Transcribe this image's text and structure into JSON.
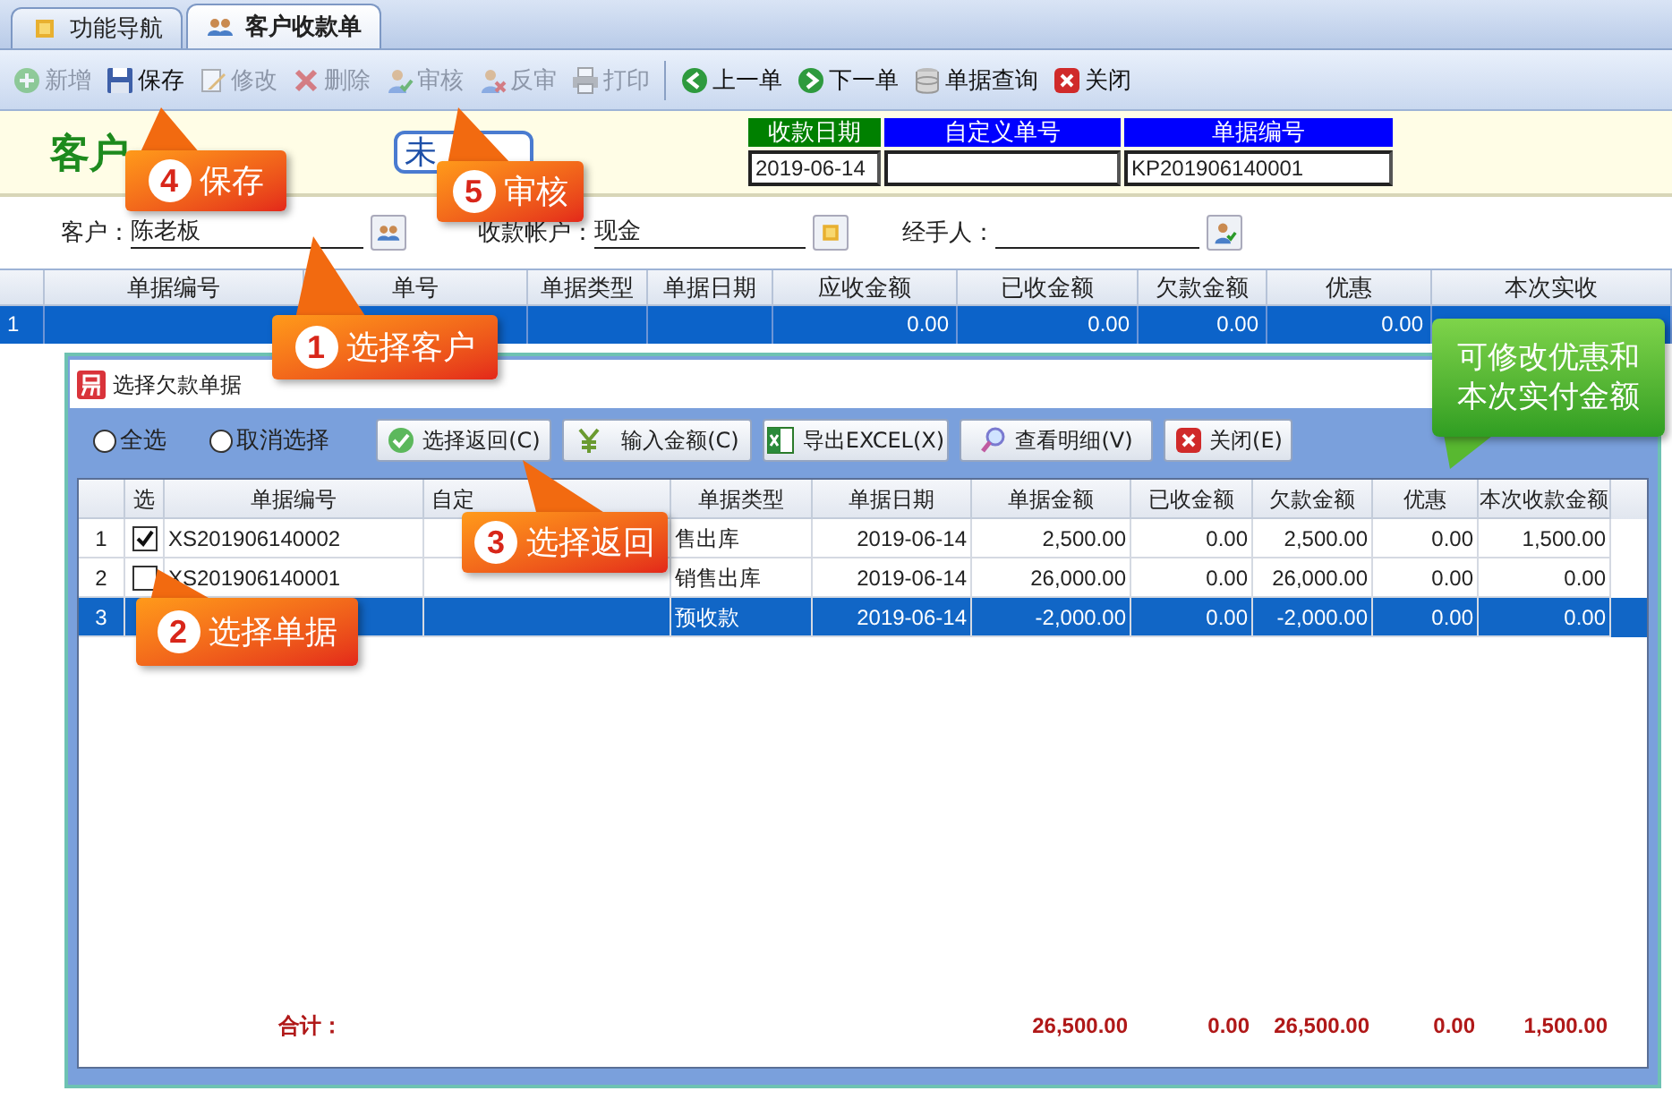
{
  "tabs": [
    {
      "label": "功能导航",
      "selected": false
    },
    {
      "label": "客户收款单",
      "selected": true
    }
  ],
  "toolbar": {
    "edit": [
      {
        "label": "新增",
        "disabled": true
      },
      {
        "label": "保存",
        "disabled": false
      },
      {
        "label": "修改",
        "disabled": true
      },
      {
        "label": "删除",
        "disabled": true
      },
      {
        "label": "审核",
        "disabled": true
      },
      {
        "label": "反审",
        "disabled": true
      },
      {
        "label": "打印",
        "disabled": true
      }
    ],
    "nav": [
      {
        "label": "上一单",
        "disabled": false
      },
      {
        "label": "下一单",
        "disabled": false
      },
      {
        "label": "单据查询",
        "disabled": false
      },
      {
        "label": "关闭",
        "disabled": false
      }
    ]
  },
  "form_title": "客户",
  "status_badge": "未",
  "header_fields": [
    {
      "label": "收款日期",
      "value": "2019-06-14",
      "color": "#008000"
    },
    {
      "label": "自定义单号",
      "color": "#0000ff"
    },
    {
      "label": "单据编号",
      "value": "KP201906140001",
      "color": "#0000ff"
    }
  ],
  "fields": [
    {
      "label": "客户：",
      "value": "陈老板"
    },
    {
      "label": "收款帐户：",
      "value": "现金"
    },
    {
      "label": "经手人："
    }
  ],
  "main_table": {
    "columns": [
      "单据编号",
      "单号",
      "单据类型",
      "单据日期",
      "应收金额",
      "已收金额",
      "欠款金额",
      "优惠",
      "本次实收"
    ],
    "rows": [
      {
        "row_number": "1",
        "receivable": "0.00",
        "received": "0.00",
        "owed": "0.00",
        "discount": "0.00",
        "selected": true
      }
    ]
  },
  "dialog": {
    "title": "选择欠款单据",
    "radios": [
      {
        "label": "全选",
        "selected": false
      },
      {
        "label": "取消选择",
        "selected": false
      }
    ],
    "buttons": [
      "选择返回(C)",
      "输入金额(C)",
      "导出EXCEL(X)",
      "查看明细(V)",
      "关闭(E)"
    ],
    "columns": [
      "选",
      "单据编号",
      "自定",
      "单据类型",
      "单据日期",
      "单据金额",
      "已收金额",
      "欠款金额",
      "优惠",
      "本次收款金额"
    ],
    "rows": [
      {
        "row_number": "1",
        "checked": true,
        "bill_no": "XS201906140002",
        "type": "售出库",
        "date": "2019-06-14",
        "amount": "2,500.00",
        "received": "0.00",
        "owed": "2,500.00",
        "discount": "0.00",
        "pay": "1,500.00",
        "selected": false
      },
      {
        "row_number": "2",
        "checked": false,
        "bill_no": "XS201906140001",
        "type": "销售出库",
        "date": "2019-06-14",
        "amount": "26,000.00",
        "received": "0.00",
        "owed": "26,000.00",
        "discount": "0.00",
        "pay": "0.00",
        "selected": false
      },
      {
        "row_number": "3",
        "type": "预收款",
        "date": "2019-06-14",
        "amount": "-2,000.00",
        "received": "0.00",
        "owed": "-2,000.00",
        "discount": "0.00",
        "pay": "0.00",
        "selected": true
      }
    ],
    "totals": {
      "label": "合计：",
      "amount": "26,500.00",
      "received": "0.00",
      "owed": "26,500.00",
      "discount": "0.00",
      "pay": "1,500.00"
    }
  },
  "callouts": [
    {
      "kind": "step",
      "number": "1",
      "text": "选择客户"
    },
    {
      "kind": "step",
      "number": "2",
      "text": "选择单据"
    },
    {
      "kind": "step",
      "number": "3",
      "text": "选择返回"
    },
    {
      "kind": "step",
      "number": "4",
      "text": "保存"
    },
    {
      "kind": "step",
      "number": "5",
      "text": "审核"
    },
    {
      "kind": "note",
      "text": "可修改优惠和本次实付金额"
    }
  ]
}
